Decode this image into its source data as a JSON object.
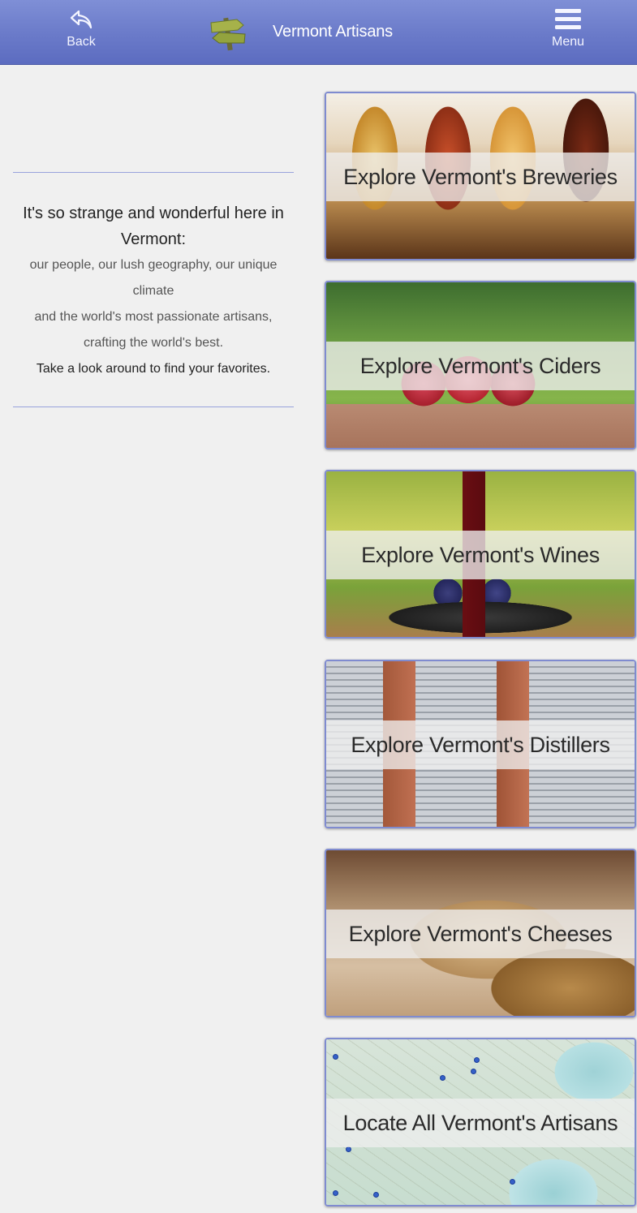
{
  "header": {
    "back_label": "Back",
    "menu_label": "Menu",
    "title": "Vermont Artisans",
    "colors": {
      "bar": "#6a7ac9",
      "text": "#ffffff"
    }
  },
  "intro": {
    "heading": "It's so strange and wonderful here in Vermont:",
    "line1": "our people, our lush geography, our unique climate",
    "line2": "and the world's most passionate artisans, crafting the world's best.",
    "cta": "Take a look around to find your favorites."
  },
  "cards": [
    {
      "label": "Explore Vermont's Breweries",
      "image": "beer-flight-photo"
    },
    {
      "label": "Explore Vermont's Ciders",
      "image": "apple-basket-photo"
    },
    {
      "label": "Explore Vermont's Wines",
      "image": "wine-and-grapes-photo"
    },
    {
      "label": "Explore Vermont's Distillers",
      "image": "copper-stills-photo"
    },
    {
      "label": "Explore Vermont's Cheeses",
      "image": "cheese-wheels-photo"
    },
    {
      "label": "Locate All Vermont's Artisans",
      "image": "vermont-map-photo"
    }
  ]
}
